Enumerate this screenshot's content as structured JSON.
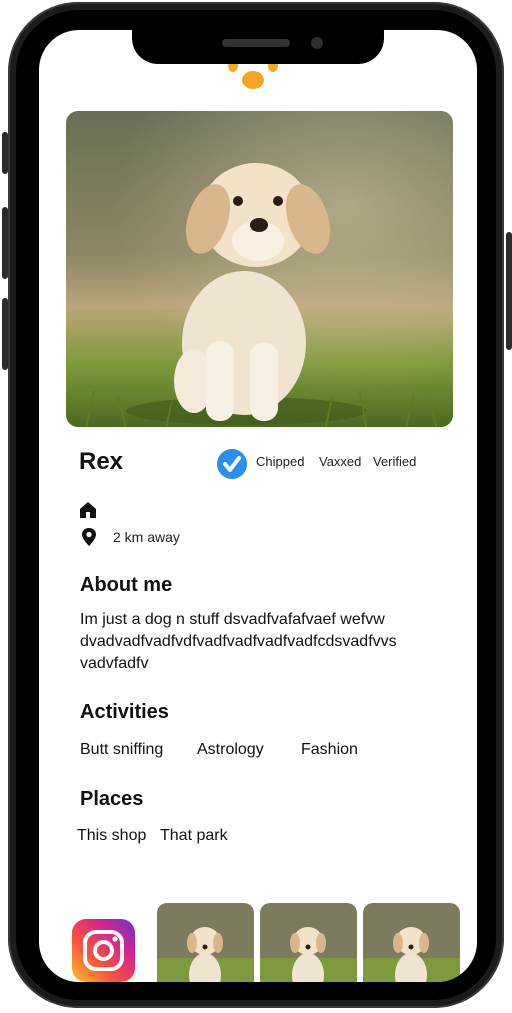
{
  "profile": {
    "name": "Rex",
    "badges": [
      "Chipped",
      "Vaxxed",
      "Verified"
    ],
    "distance": "2 km away"
  },
  "about": {
    "heading": "About me",
    "text": "Im just a dog n stuff dsvadfvafafvaef wefvw dvadvadfvadfvdfvadfvadfvadfvadfcdsvadfvvs vadvfadfv"
  },
  "activities": {
    "heading": "Activities",
    "items": [
      "Butt sniffing",
      "Astrology",
      "Fashion"
    ]
  },
  "places": {
    "heading": "Places",
    "items": [
      "This shop",
      "That park"
    ]
  },
  "colors": {
    "accent": "#f5a623",
    "check": "#2b8ef0"
  },
  "icons": [
    "paw-icon",
    "check-badge-icon",
    "home-icon",
    "location-pin-icon",
    "instagram-icon"
  ]
}
